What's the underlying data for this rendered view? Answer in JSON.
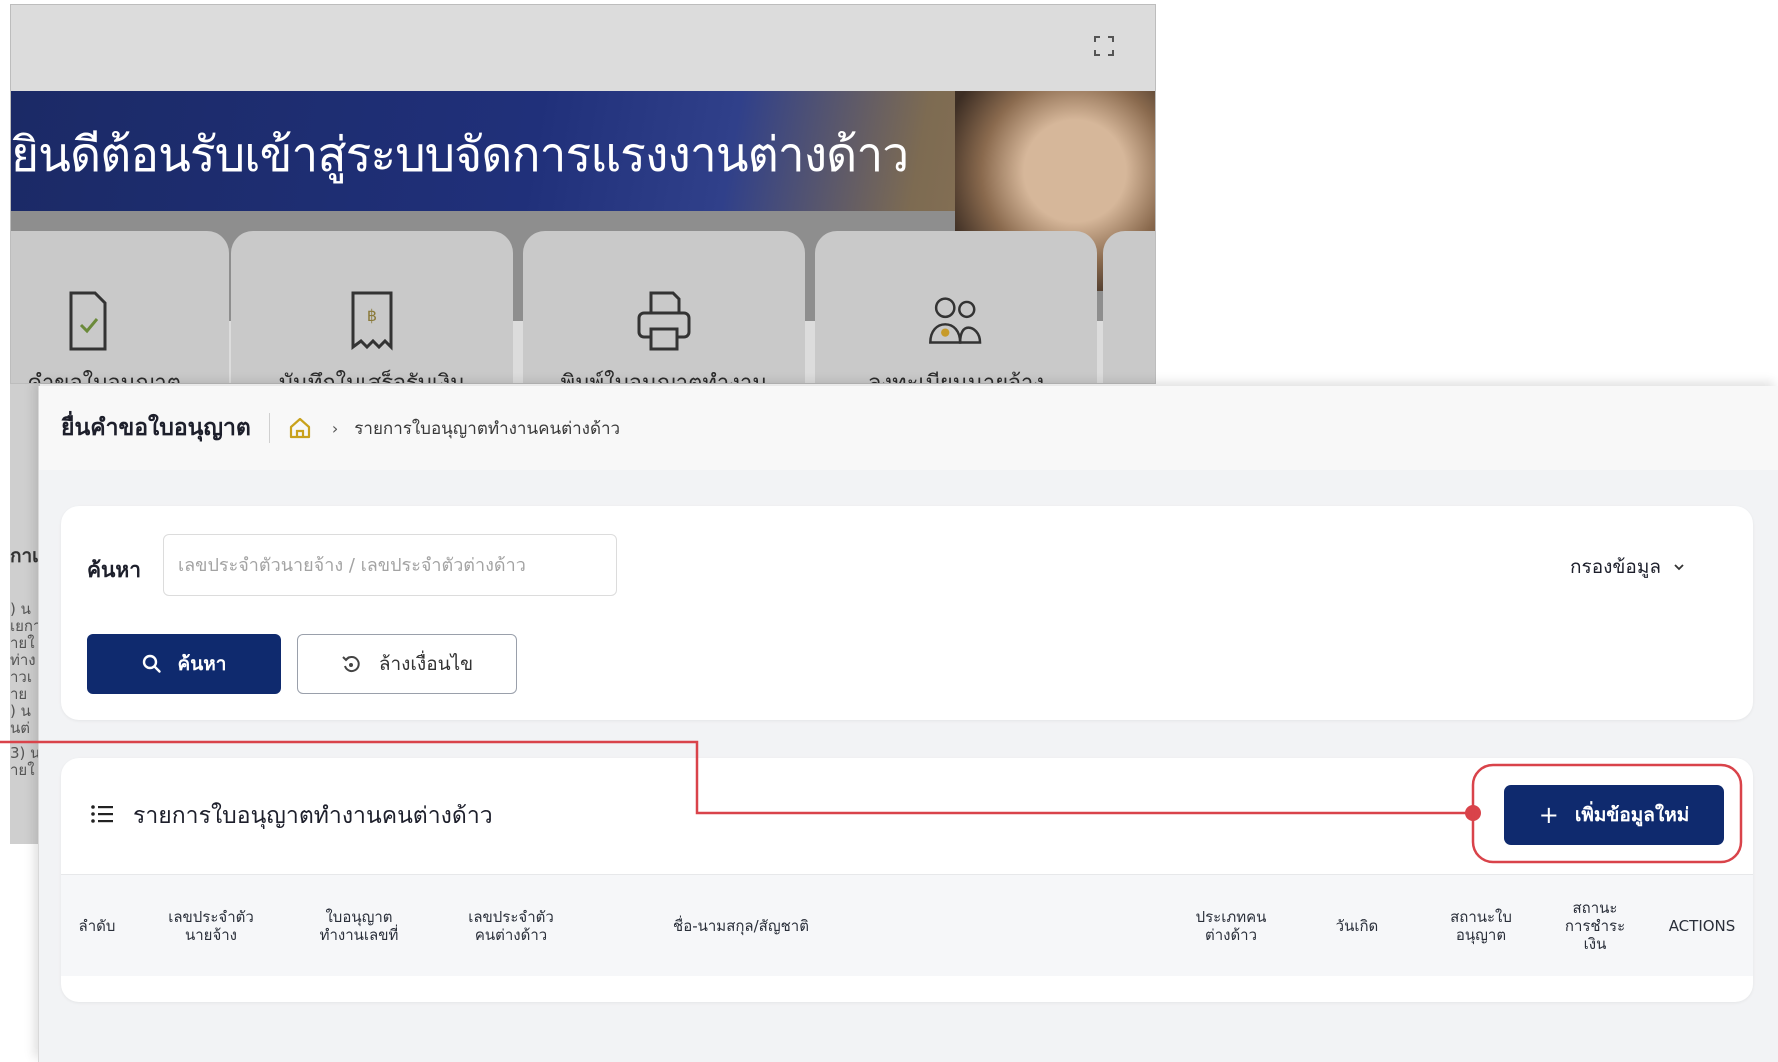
{
  "background": {
    "welcome_text": "ยินดีต้อนรับเข้าสู่ระบบจัดการแรงงานต่างด้าว",
    "cards": [
      {
        "label": "คำขอใบอนุญาต",
        "icon": "document-check-icon"
      },
      {
        "label": "บันทึกใบเสร็จรับเงิน",
        "icon": "receipt-baht-icon"
      },
      {
        "label": "พิมพ์ใบอนุญาตทำงาน",
        "icon": "printer-icon"
      },
      {
        "label": "ลงทะเบียนนายจ้าง",
        "icon": "users-icon"
      }
    ],
    "left_fragments": [
      "กาเ",
      ") น",
      "เยกา",
      "ายใ",
      "ท่าง",
      "าวเ",
      "าย",
      ") น",
      "นต่",
      "3) น",
      "ายใ"
    ]
  },
  "topbar": {
    "title": "ยื่นคำขอใบอนุญาต",
    "breadcrumb_home_icon": "home-icon",
    "breadcrumb_current": "รายการใบอนุญาตทำงานคนต่างด้าว"
  },
  "search": {
    "label": "ค้นหา",
    "placeholder": "เลขประจำตัวนายจ้าง / เลขประจำตัวต่างด้าว",
    "value": "",
    "filter_label": "กรองข้อมูล",
    "search_button": "ค้นหา",
    "clear_button": "ล้างเงื่อนไข"
  },
  "list": {
    "title": "รายการใบอนุญาตทำงานคนต่างด้าว",
    "add_button_icon": "+",
    "add_button": "เพิ่มข้อมูลใหม่",
    "columns": [
      "ลำดับ",
      "เลขประจำตัว\nนายจ้าง",
      "ใบอนุญาต\nทำงานเลขที่",
      "เลขประจำตัว\nคนต่างด้าว",
      "ชื่อ-นามสกุล/สัญชาติ",
      "ประเภทคน\nต่างด้าว",
      "วันเกิด",
      "สถานะใบ\nอนุญาต",
      "สถานะ\nการชำระ\nเงิน",
      "ACTIONS"
    ]
  },
  "colors": {
    "primary": "#0f2a6e",
    "annotation": "#d9434a",
    "home_icon": "#c9a21c"
  }
}
